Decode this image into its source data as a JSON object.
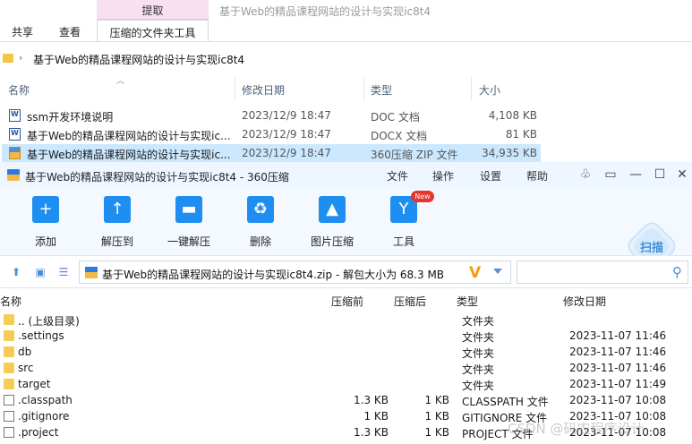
{
  "explorer": {
    "context_group": "提取",
    "window_title": "基于Web的精品课程网站的设计与实现ic8t4",
    "tabs": [
      "共享",
      "查看",
      "压缩的文件夹工具"
    ],
    "breadcrumb": "基于Web的精品课程网站的设计与实现ic8t4",
    "columns": [
      "名称",
      "修改日期",
      "类型",
      "大小"
    ],
    "files": [
      {
        "name": "ssm开发环境说明",
        "date": "2023/12/9 18:47",
        "type": "DOC 文档",
        "size": "4,108 KB"
      },
      {
        "name": "基于Web的精品课程网站的设计与实现ic...",
        "date": "2023/12/9 18:47",
        "type": "DOCX 文档",
        "size": "81 KB"
      },
      {
        "name": "基于Web的精品课程网站的设计与实现ic...",
        "date": "2023/12/9 18:47",
        "type": "360压缩 ZIP 文件",
        "size": "34,935 KB"
      }
    ]
  },
  "zipwin": {
    "title": "基于Web的精品课程网站的设计与实现ic8t4 - 360压缩",
    "menus": [
      "文件",
      "操作",
      "设置",
      "帮助"
    ],
    "tools": [
      {
        "label": "添加",
        "icon": "add-icon",
        "glyph": "+"
      },
      {
        "label": "解压到",
        "icon": "extract-to-icon",
        "glyph": "↑"
      },
      {
        "label": "一键解压",
        "icon": "one-click-extract-icon",
        "glyph": "▬"
      },
      {
        "label": "删除",
        "icon": "delete-icon",
        "glyph": "♻"
      },
      {
        "label": "图片压缩",
        "icon": "image-compress-icon",
        "glyph": "▲"
      },
      {
        "label": "工具",
        "icon": "tools-icon",
        "glyph": "Y"
      }
    ],
    "new_badge": "New",
    "scan_label": "扫描",
    "path": "基于Web的精品课程网站的设计与实现ic8t4.zip - 解包大小为 68.3 MB",
    "search_placeholder": "",
    "columns": [
      "名称",
      "压缩前",
      "压缩后",
      "类型",
      "修改日期"
    ],
    "entries": [
      {
        "name": ".. (上级目录)",
        "before": "",
        "after": "",
        "type": "文件夹",
        "date": "",
        "kind": "folder"
      },
      {
        "name": ".settings",
        "before": "",
        "after": "",
        "type": "文件夹",
        "date": "2023-11-07 11:46",
        "kind": "folder"
      },
      {
        "name": "db",
        "before": "",
        "after": "",
        "type": "文件夹",
        "date": "2023-11-07 11:46",
        "kind": "folder"
      },
      {
        "name": "src",
        "before": "",
        "after": "",
        "type": "文件夹",
        "date": "2023-11-07 11:46",
        "kind": "folder"
      },
      {
        "name": "target",
        "before": "",
        "after": "",
        "type": "文件夹",
        "date": "2023-11-07 11:49",
        "kind": "folder"
      },
      {
        "name": ".classpath",
        "before": "1.3 KB",
        "after": "1 KB",
        "type": "CLASSPATH 文件",
        "date": "2023-11-07 10:08",
        "kind": "file"
      },
      {
        "name": ".gitignore",
        "before": "1 KB",
        "after": "1 KB",
        "type": "GITIGNORE 文件",
        "date": "2023-11-07 10:08",
        "kind": "file"
      },
      {
        "name": ".project",
        "before": "1.3 KB",
        "after": "1 KB",
        "type": "PROJECT 文件",
        "date": "2023-11-07 10:08",
        "kind": "file"
      }
    ]
  },
  "watermark": "CSDN @码农程序设计"
}
